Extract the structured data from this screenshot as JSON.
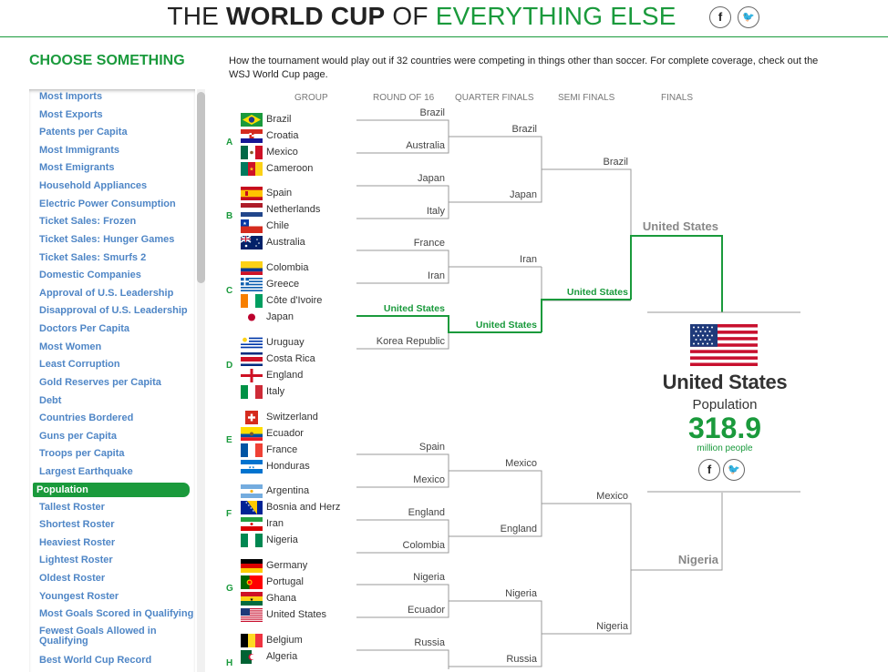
{
  "header": {
    "title_part1": "THE ",
    "title_part2": "WORLD CUP",
    "title_part3": " OF ",
    "title_part4": "EVERYTHING ELSE",
    "facebook_label": "f",
    "twitter_label": "🐦"
  },
  "sidebar": {
    "heading": "CHOOSE SOMETHING",
    "items": [
      "Most Imports",
      "Most Exports",
      "Patents per Capita",
      "Most Immigrants",
      "Most Emigrants",
      "Household Appliances",
      "Electric Power Consumption",
      "Ticket Sales: Frozen",
      "Ticket Sales: Hunger Games",
      "Ticket Sales: Smurfs 2",
      "Domestic Companies",
      "Approval of U.S. Leadership",
      "Disapproval of U.S. Leadership",
      "Doctors Per Capita",
      "Most Women",
      "Least Corruption",
      "Gold Reserves per Capita",
      "Debt",
      "Countries Bordered",
      "Guns per Capita",
      "Troops per Capita",
      "Largest Earthquake",
      "Population",
      "Tallest Roster",
      "Shortest Roster",
      "Heaviest Roster",
      "Lightest Roster",
      "Oldest Roster",
      "Youngest Roster",
      "Most Goals Scored in Qualifying",
      "Fewest Goals Allowed in Qualifying",
      "Best World Cup Record"
    ],
    "active_item": "Population"
  },
  "description": "How the tournament would play out if 32 countries were competing in things other than soccer. For complete coverage, check out the WSJ World Cup page.",
  "columns": {
    "group": "GROUP",
    "round16": "ROUND OF 16",
    "quarter": "QUARTER FINALS",
    "semi": "SEMI FINALS",
    "finals": "FINALS"
  },
  "groups": [
    {
      "letter": "A",
      "teams": [
        {
          "name": "Brazil",
          "flag": "brazil-flag"
        },
        {
          "name": "Croatia",
          "flag": "croatia-flag"
        },
        {
          "name": "Mexico",
          "flag": "mexico-flag"
        },
        {
          "name": "Cameroon",
          "flag": "cameroon-flag"
        }
      ]
    },
    {
      "letter": "B",
      "teams": [
        {
          "name": "Spain",
          "flag": "spain-flag"
        },
        {
          "name": "Netherlands",
          "flag": "netherlands-flag"
        },
        {
          "name": "Chile",
          "flag": "chile-flag"
        },
        {
          "name": "Australia",
          "flag": "australia-flag"
        }
      ]
    },
    {
      "letter": "C",
      "teams": [
        {
          "name": "Colombia",
          "flag": "colombia-flag"
        },
        {
          "name": "Greece",
          "flag": "greece-flag"
        },
        {
          "name": "Côte d'Ivoire",
          "flag": "cote-divoire-flag"
        },
        {
          "name": "Japan",
          "flag": "japan-flag"
        }
      ]
    },
    {
      "letter": "D",
      "teams": [
        {
          "name": "Uruguay",
          "flag": "uruguay-flag"
        },
        {
          "name": "Costa Rica",
          "flag": "costa-rica-flag"
        },
        {
          "name": "England",
          "flag": "england-flag"
        },
        {
          "name": "Italy",
          "flag": "italy-flag"
        }
      ]
    },
    {
      "letter": "E",
      "teams": [
        {
          "name": "Switzerland",
          "flag": "switzerland-flag"
        },
        {
          "name": "Ecuador",
          "flag": "ecuador-flag"
        },
        {
          "name": "France",
          "flag": "france-flag"
        },
        {
          "name": "Honduras",
          "flag": "honduras-flag"
        }
      ]
    },
    {
      "letter": "F",
      "teams": [
        {
          "name": "Argentina",
          "flag": "argentina-flag"
        },
        {
          "name": "Bosnia and Herz",
          "flag": "bosnia-flag"
        },
        {
          "name": "Iran",
          "flag": "iran-flag"
        },
        {
          "name": "Nigeria",
          "flag": "nigeria-flag"
        }
      ]
    },
    {
      "letter": "G",
      "teams": [
        {
          "name": "Germany",
          "flag": "germany-flag"
        },
        {
          "name": "Portugal",
          "flag": "portugal-flag"
        },
        {
          "name": "Ghana",
          "flag": "ghana-flag"
        },
        {
          "name": "United States",
          "flag": "usa-flag"
        }
      ]
    },
    {
      "letter": "H",
      "teams": [
        {
          "name": "Belgium",
          "flag": "belgium-flag"
        },
        {
          "name": "Algeria",
          "flag": "algeria-flag"
        }
      ]
    }
  ],
  "bracket": {
    "round16": [
      "Brazil",
      "Australia",
      "Japan",
      "Italy",
      "France",
      "Iran",
      "United States",
      "Korea Republic",
      "Spain",
      "Mexico",
      "England",
      "Colombia",
      "Nigeria",
      "Ecuador",
      "Russia"
    ],
    "quarter": [
      "Brazil",
      "Japan",
      "Iran",
      "United States",
      "Mexico",
      "England",
      "Nigeria",
      "Russia"
    ],
    "semi": [
      "Brazil",
      "United States",
      "Mexico",
      "Nigeria"
    ],
    "finals": [
      "United States",
      "Nigeria"
    ]
  },
  "winner": {
    "name": "United States",
    "category": "Population",
    "value": "318.9",
    "unit": "million people",
    "flag": "usa-flag"
  },
  "colors": {
    "accent": "#1a9a3c",
    "link": "#4f86c6",
    "line": "#999999"
  }
}
